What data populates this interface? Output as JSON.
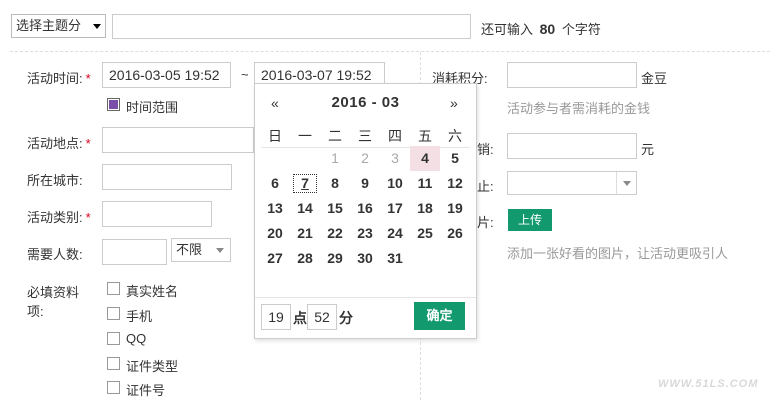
{
  "top": {
    "topic_select": "选择主题分",
    "title_input_value": "",
    "char_hint_prefix": "还可输入",
    "char_hint_count": "80",
    "char_hint_suffix": "个字符"
  },
  "form": {
    "time_label": "活动时间:",
    "required_mark": "*",
    "start_time": "2016-03-05 19:52",
    "range_sep": "~",
    "end_time": "2016-03-07 19:52",
    "time_range_label": "时间范围",
    "location_label": "活动地点:",
    "city_label": "所在城市:",
    "category_label": "活动类别:",
    "people_label": "需要人数:",
    "people_limit": "不限",
    "required_fields_label_1": "必填资料",
    "required_fields_label_2": "项:",
    "fields": [
      "真实姓名",
      "手机",
      "QQ",
      "证件类型",
      "证件号"
    ]
  },
  "right": {
    "points_label": "消耗积分:",
    "points_unit": "金豆",
    "points_hint": "活动参与者需消耗的金钱",
    "fee_label_partial": "销:",
    "fee_unit": "元",
    "stop_label_partial": "止:",
    "pic_label_partial": "片:",
    "upload_btn": "上传",
    "pic_hint": "添加一张好看的图片，让活动更吸引人"
  },
  "calendar": {
    "prev": "«",
    "next": "»",
    "title": "2016 - 03",
    "weekdays": [
      "日",
      "一",
      "二",
      "三",
      "四",
      "五",
      "六"
    ],
    "days": [
      "1",
      "2",
      "3",
      "4",
      "5",
      "6",
      "7",
      "8",
      "9",
      "10",
      "11",
      "12",
      "13",
      "14",
      "15",
      "16",
      "17",
      "18",
      "19",
      "20",
      "21",
      "22",
      "23",
      "24",
      "25",
      "26",
      "27",
      "28",
      "29",
      "30",
      "31"
    ],
    "hour": "19",
    "hour_unit": "点",
    "minute": "52",
    "minute_unit": "分",
    "ok": "确定"
  },
  "watermark": "WWW.51LS.COM"
}
